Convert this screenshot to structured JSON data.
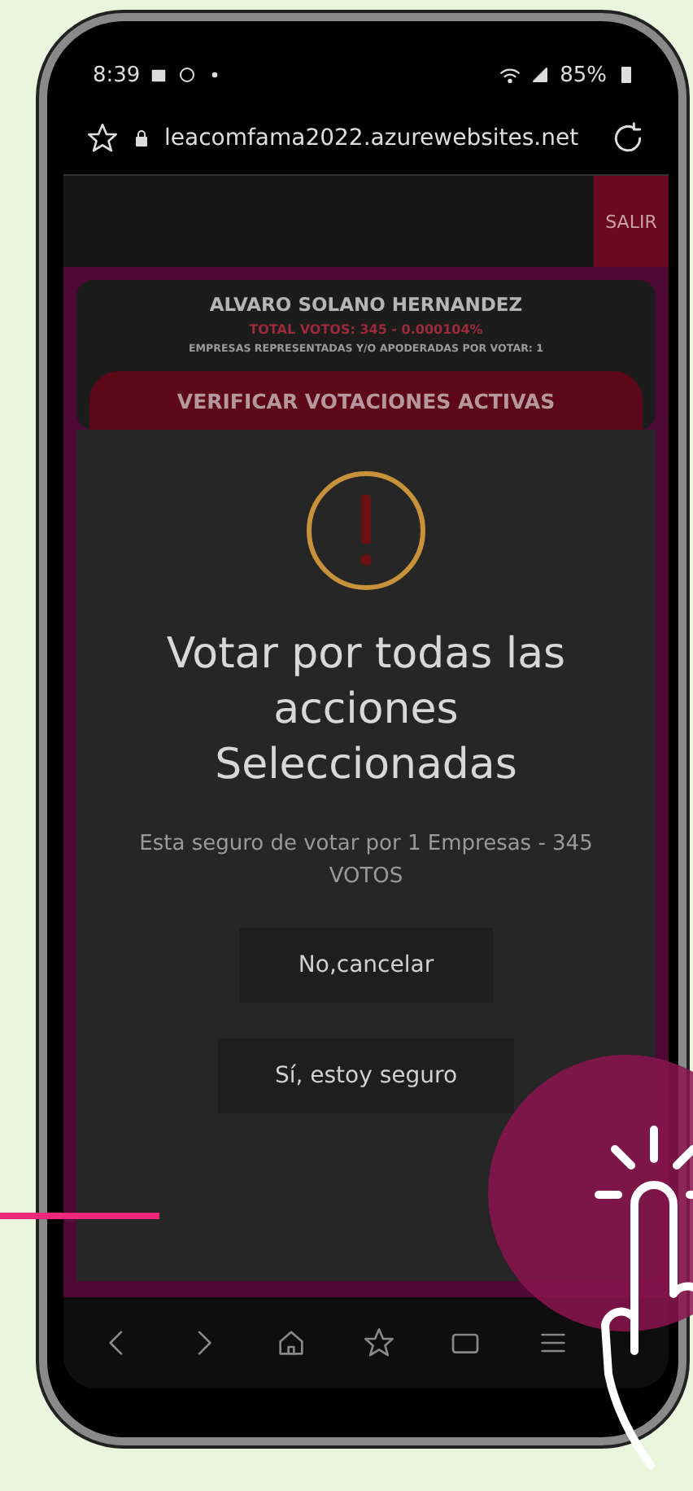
{
  "status_bar": {
    "time": "8:39",
    "battery": "85%"
  },
  "browser": {
    "url": "leacomfama2022.azurewebsites.net"
  },
  "header": {
    "logout": "SALIR"
  },
  "voter_card": {
    "name": "ALVARO SOLANO HERNANDEZ",
    "total_votes": "TOTAL VOTOS: 345 - 0.000104%",
    "companies": "EMPRESAS REPRESENTADAS Y/O APODERADAS POR VOTAR: 1",
    "button": "VERIFICAR VOTACIONES ACTIVAS"
  },
  "dialog": {
    "title": "Votar por todas las acciones Seleccionadas",
    "message": "Esta seguro de votar por 1 Empresas - 345 VOTOS",
    "buttons": [
      {
        "label": "No,cancelar"
      },
      {
        "label": "Sí, estoy seguro"
      }
    ]
  }
}
